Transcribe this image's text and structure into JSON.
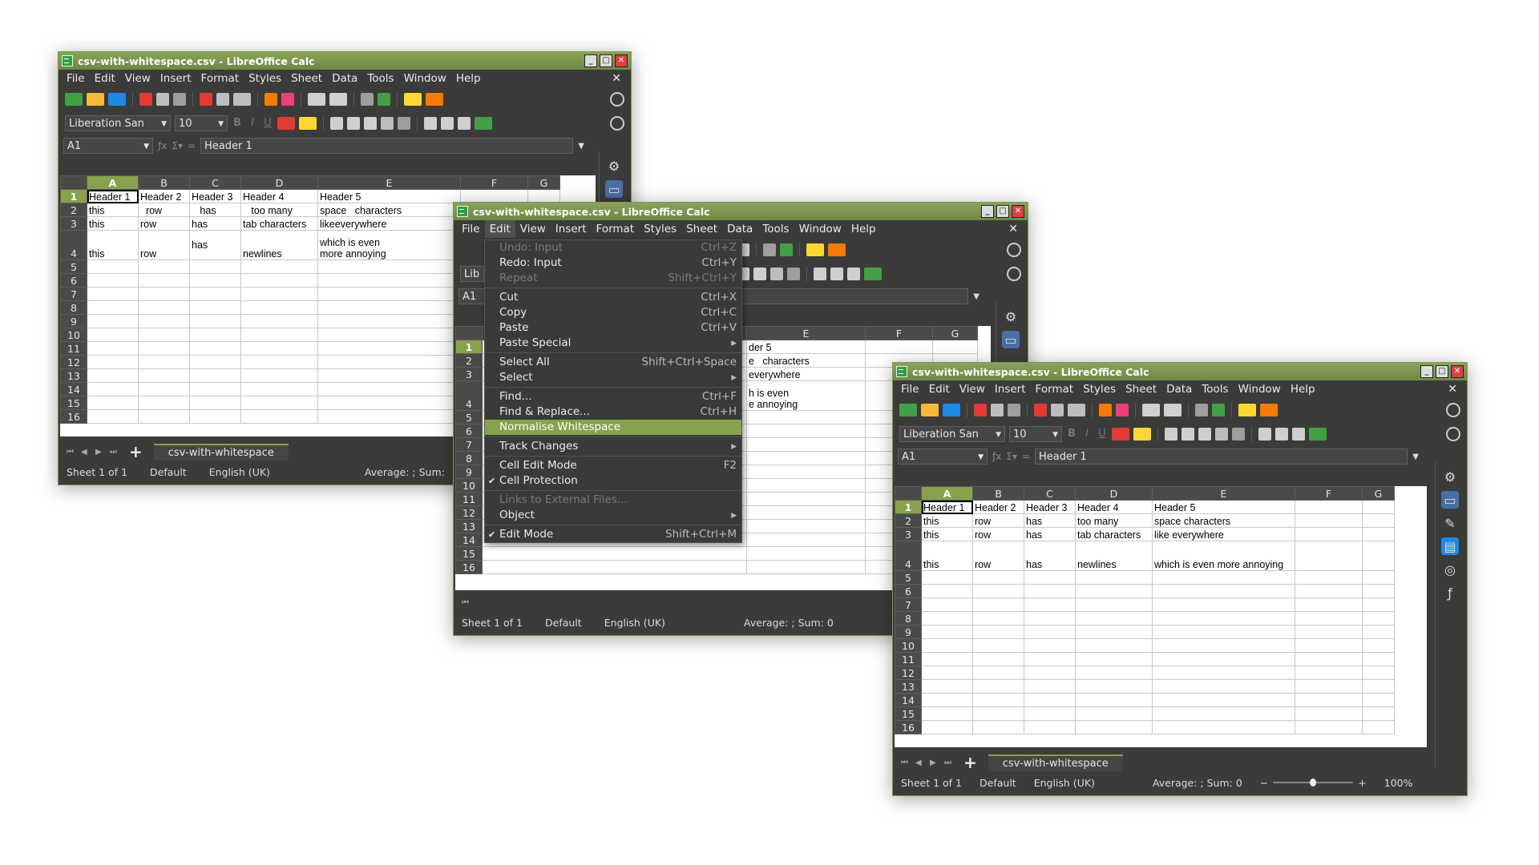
{
  "app": {
    "window_title": "csv-with-whitespace.csv - LibreOffice Calc",
    "menus": [
      "File",
      "Edit",
      "View",
      "Insert",
      "Format",
      "Styles",
      "Sheet",
      "Data",
      "Tools",
      "Window",
      "Help"
    ],
    "win_buttons": {
      "minimize": "_",
      "maximize": "□",
      "close": "✕"
    },
    "doc_close": "✕"
  },
  "formatting": {
    "font_name": "Liberation San",
    "font_size": "10"
  },
  "formula_bar": {
    "cell_ref": "A1",
    "content": "Header 1"
  },
  "columns": [
    "A",
    "B",
    "C",
    "D",
    "E",
    "F",
    "G"
  ],
  "row_numbers": [
    "1",
    "2",
    "3",
    "4",
    "5",
    "6",
    "7",
    "8",
    "9",
    "10",
    "11",
    "12",
    "13",
    "14",
    "15",
    "16"
  ],
  "sheet_tab": "csv-with-whitespace",
  "status": {
    "sheet": "Sheet 1 of 1",
    "style": "Default",
    "language": "English (UK)",
    "sum": "Average: ; Sum: 0",
    "sum_short": "Average: ; Sum:",
    "zoom": "100%"
  },
  "before": {
    "rows": [
      [
        "Header 1",
        "Header 2",
        "Header 3",
        "Header 4",
        "Header 5"
      ],
      [
        "this",
        "  row",
        "   has",
        "   too many",
        "space   characters"
      ],
      [
        "this",
        "row",
        "has",
        "tab characters",
        "likeeverywhere"
      ],
      [
        "this",
        "row",
        "has",
        "newlines",
        "which is even\nmore annoying"
      ]
    ]
  },
  "after": {
    "rows": [
      [
        "Header 1",
        "Header 2",
        "Header 3",
        "Header 4",
        "Header 5"
      ],
      [
        "this",
        "row",
        "has",
        "too many",
        "space characters"
      ],
      [
        "this",
        "row",
        "has",
        "tab characters",
        "like everywhere"
      ],
      [
        "this",
        "row",
        "has",
        "newlines",
        "which is even more annoying"
      ]
    ]
  },
  "middle_visible_e": [
    "der 5",
    "e   characters",
    "everywhere",
    "h is even\ne annoying"
  ],
  "middle_name_box": "A1",
  "middle_font_stub": "Lib",
  "edit_menu": {
    "items": [
      {
        "label": "Undo: Input",
        "shortcut": "Ctrl+Z",
        "state": "disabled"
      },
      {
        "label": "Redo: Input",
        "shortcut": "Ctrl+Y",
        "state": "normal"
      },
      {
        "label": "Repeat",
        "shortcut": "Shift+Ctrl+Y",
        "state": "disabled"
      },
      {
        "sep": true
      },
      {
        "label": "Cut",
        "shortcut": "Ctrl+X",
        "state": "normal"
      },
      {
        "label": "Copy",
        "shortcut": "Ctrl+C",
        "state": "normal"
      },
      {
        "label": "Paste",
        "shortcut": "Ctrl+V",
        "state": "normal"
      },
      {
        "label": "Paste Special",
        "shortcut": "▸",
        "state": "normal"
      },
      {
        "sep": true
      },
      {
        "label": "Select All",
        "shortcut": "Shift+Ctrl+Space",
        "state": "normal"
      },
      {
        "label": "Select",
        "shortcut": "▸",
        "state": "normal"
      },
      {
        "sep": true
      },
      {
        "label": "Find...",
        "shortcut": "Ctrl+F",
        "state": "normal"
      },
      {
        "label": "Find & Replace...",
        "shortcut": "Ctrl+H",
        "state": "normal"
      },
      {
        "label": "Normalise Whitespace",
        "shortcut": "",
        "state": "highlighted"
      },
      {
        "sep": true
      },
      {
        "label": "Track Changes",
        "shortcut": "▸",
        "state": "normal"
      },
      {
        "sep": true
      },
      {
        "label": "Cell Edit Mode",
        "shortcut": "F2",
        "state": "normal"
      },
      {
        "label": "Cell Protection",
        "shortcut": "",
        "state": "checked"
      },
      {
        "sep": true
      },
      {
        "label": "Links to External Files...",
        "shortcut": "",
        "state": "disabled"
      },
      {
        "label": "Object",
        "shortcut": "▸",
        "state": "normal"
      },
      {
        "sep": true
      },
      {
        "label": "Edit Mode",
        "shortcut": "Shift+Ctrl+M",
        "state": "checked"
      }
    ]
  },
  "icon_colors": {
    "green": "#43a047",
    "orange": "#f57c00",
    "red": "#e53935",
    "yellow": "#fdd835",
    "blue": "#1e88e5",
    "gray": "#9e9e9e",
    "accent": "#86a24d"
  }
}
